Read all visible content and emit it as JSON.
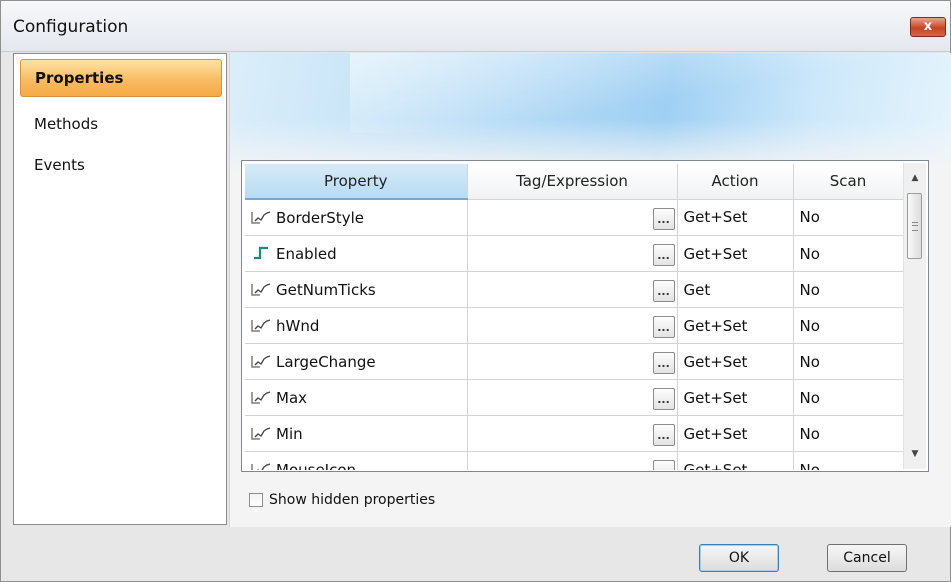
{
  "window": {
    "title": "Configuration",
    "close_label": "x"
  },
  "sidebar": {
    "items": [
      {
        "label": "Properties",
        "selected": true
      },
      {
        "label": "Methods",
        "selected": false
      },
      {
        "label": "Events",
        "selected": false
      }
    ]
  },
  "grid": {
    "columns": [
      "Property",
      "Tag/Expression",
      "Action",
      "Scan"
    ],
    "rows": [
      {
        "icon": "analog-tag-icon",
        "property": "BorderStyle",
        "tag": "",
        "action": "Get+Set",
        "scan": "No"
      },
      {
        "icon": "digital-tag-icon",
        "property": "Enabled",
        "tag": "",
        "action": "Get+Set",
        "scan": "No"
      },
      {
        "icon": "analog-tag-icon",
        "property": "GetNumTicks",
        "tag": "",
        "action": "Get",
        "scan": "No"
      },
      {
        "icon": "analog-tag-icon",
        "property": "hWnd",
        "tag": "",
        "action": "Get+Set",
        "scan": "No"
      },
      {
        "icon": "analog-tag-icon",
        "property": "LargeChange",
        "tag": "",
        "action": "Get+Set",
        "scan": "No"
      },
      {
        "icon": "analog-tag-icon",
        "property": "Max",
        "tag": "",
        "action": "Get+Set",
        "scan": "No"
      },
      {
        "icon": "analog-tag-icon",
        "property": "Min",
        "tag": "",
        "action": "Get+Set",
        "scan": "No"
      },
      {
        "icon": "analog-tag-icon",
        "property": "MouseIcon",
        "tag": "",
        "action": "Get+Set",
        "scan": "No"
      }
    ],
    "ellipsis_label": "...",
    "scrollbar": {
      "up_icon": "scroll-up-arrow-icon",
      "down_icon": "scroll-down-arrow-icon"
    }
  },
  "options": {
    "show_hidden_label": "Show hidden properties",
    "show_hidden_checked": false
  },
  "buttons": {
    "ok_label": "OK",
    "cancel_label": "Cancel"
  },
  "colors": {
    "selected_nav_top": "#fde3a6",
    "selected_nav_bottom": "#f6aa46",
    "header_selected": "#b7dbf3",
    "digital_icon": "#1a8a7a"
  }
}
